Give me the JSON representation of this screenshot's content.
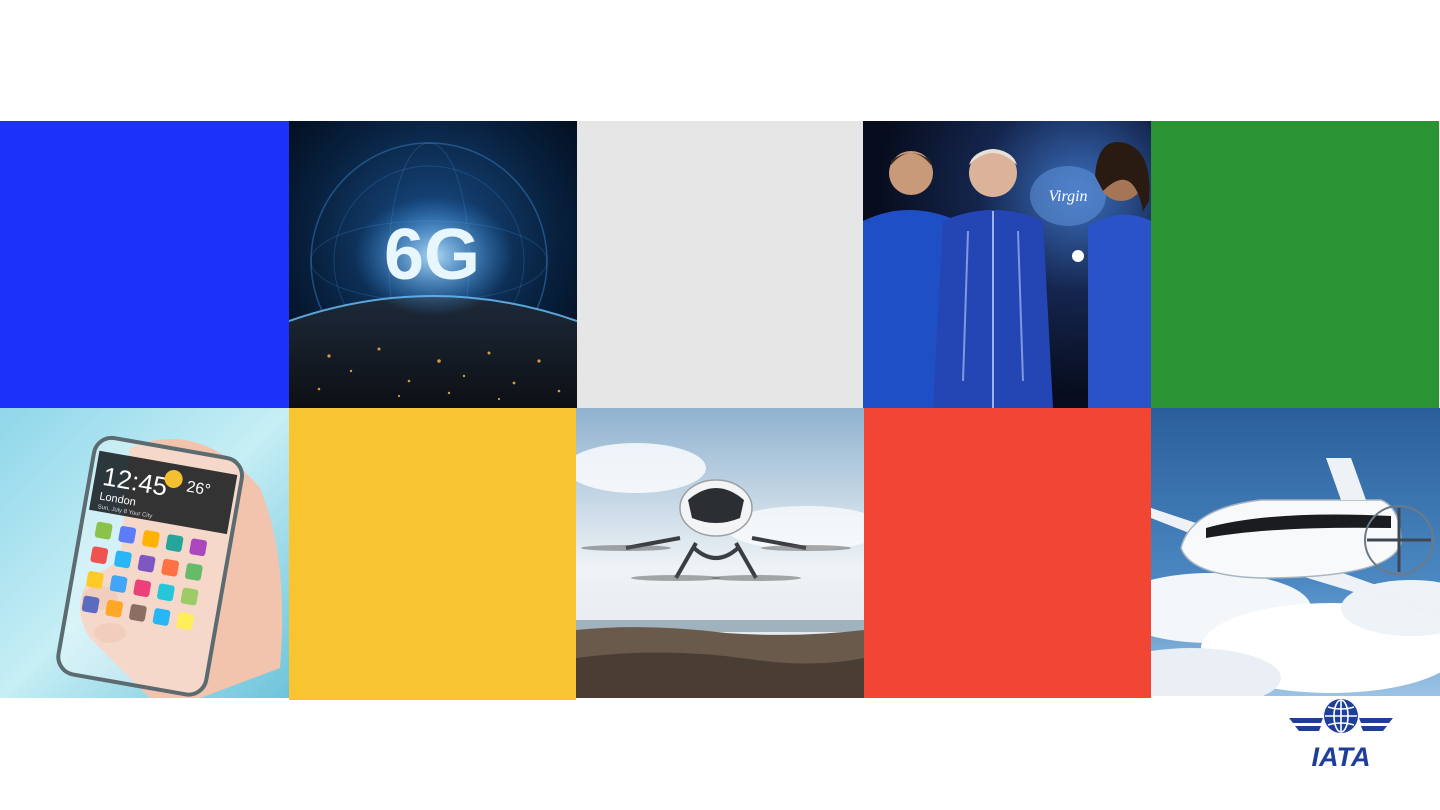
{
  "slide": {
    "background": "#ffffff",
    "tiles": [
      {
        "id": "blue-block",
        "color": "#1c32fb"
      },
      {
        "id": "photo-6g-earth",
        "caption": "6G"
      },
      {
        "id": "grey-block",
        "color": "#e6e6e6"
      },
      {
        "id": "photo-virgin-galactic-crew",
        "caption": "Virgin"
      },
      {
        "id": "green-block",
        "color": "#2a9334"
      },
      {
        "id": "photo-transparent-smartphone",
        "time": "12:45",
        "temperature": "26°",
        "city": "London",
        "date": "Sun, July 8  Your City"
      },
      {
        "id": "yellow-block",
        "color": "#f8c530"
      },
      {
        "id": "photo-passenger-drone"
      },
      {
        "id": "red-block",
        "color": "#f04633"
      },
      {
        "id": "photo-electric-aircraft"
      }
    ]
  },
  "logo": {
    "text": "IATA",
    "color": "#1e3e9a"
  }
}
